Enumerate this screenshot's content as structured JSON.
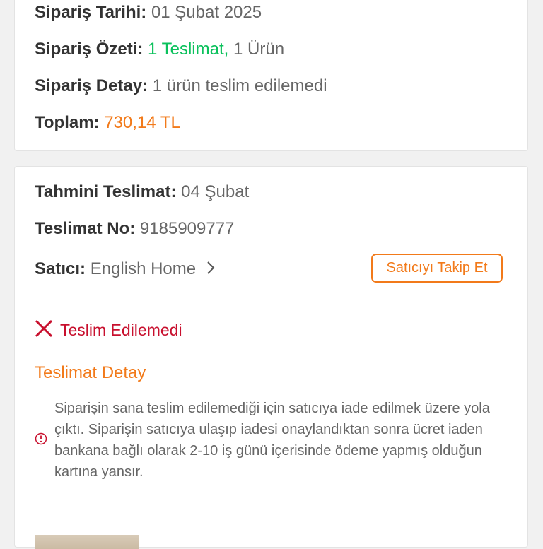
{
  "summary": {
    "date_label": "Sipariş Tarihi:",
    "date_value": "01 Şubat 2025",
    "overview_label": "Sipariş Özeti:",
    "overview_delivery": "1 Teslimat,",
    "overview_items": "1 Ürün",
    "detail_label": "Sipariş Detay:",
    "detail_value": "1 ürün teslim edilemedi",
    "total_label": "Toplam:",
    "total_value": "730,14 TL"
  },
  "delivery": {
    "estimated_label": "Tahmini Teslimat:",
    "estimated_value": "04 Şubat",
    "number_label": "Teslimat No:",
    "number_value": "9185909777",
    "seller_label": "Satıcı:",
    "seller_name": "English Home",
    "follow_button": "Satıcıyı Takip Et",
    "status_text": "Teslim Edilemedi",
    "detail_title": "Teslimat Detay",
    "info_text": "Siparişin sana teslim edilemediği için satıcıya iade edilmek üzere yola çıktı. Siparişin satıcıya ulaşıp iadesi onaylandıktan sonra ücret iaden bankana bağlı olarak 2-10 iş günü içerisinde ödeme yapmış olduğun kartına yansır."
  },
  "icons": {
    "status": "close-icon",
    "info": "info-icon",
    "seller_link": "chevron-right-icon"
  },
  "colors": {
    "accent": "#f27a1a",
    "success": "#0bc15c",
    "error": "#c8102e"
  }
}
